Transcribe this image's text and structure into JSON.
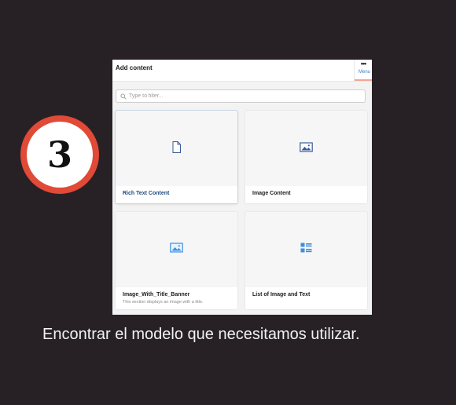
{
  "step": {
    "number": "3"
  },
  "panel": {
    "title": "Add content",
    "menu": {
      "dots": "•••",
      "label": "Menu"
    },
    "filter": {
      "placeholder": "Type to filter..."
    },
    "cards": [
      {
        "name": "Rich Text Content",
        "description": "",
        "icon": "document-icon",
        "selected": true
      },
      {
        "name": "Image Content",
        "description": "",
        "icon": "image-icon"
      },
      {
        "name": "Image_With_Title_Banner",
        "description": "This section displays an image with a title.",
        "icon": "image-icon"
      },
      {
        "name": "List of Image and Text",
        "description": "",
        "icon": "list-icon"
      }
    ]
  },
  "caption": "Encontrar el modelo que necesitamos utilizar.",
  "colors": {
    "background": "#272126",
    "badge_ring": "#e04a36",
    "icon_blue_dark": "#3c5a9a",
    "icon_blue_light": "#3c8fe0",
    "menu_underline": "#f5a58f"
  }
}
